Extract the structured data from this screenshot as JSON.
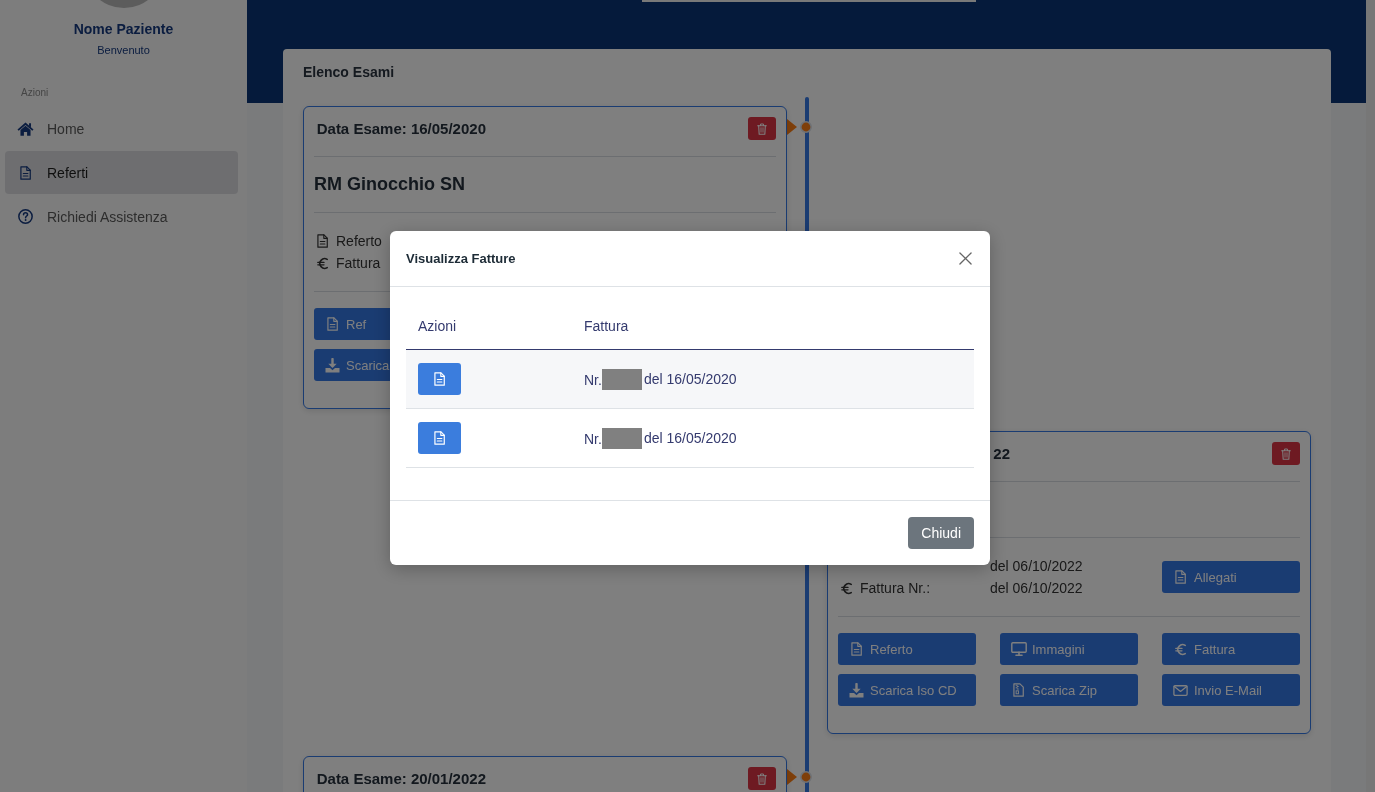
{
  "sidebar": {
    "name": "Nome Paziente",
    "greeting": "Benvenuto",
    "section": "Azioni",
    "items": [
      {
        "kind": "home",
        "label": "Home",
        "selected": false
      },
      {
        "kind": "file",
        "label": "Referti",
        "selected": true
      },
      {
        "kind": "help",
        "label": "Richiedi Assistenza",
        "selected": false
      }
    ]
  },
  "main": {
    "title": "Elenco Esami",
    "exams": [
      {
        "title": "Data Esame: 16/05/2020",
        "exam_name": "RM Ginocchio SN",
        "info_rows": [
          {
            "kind": "file",
            "label": "Referto"
          },
          {
            "kind": "euro",
            "label": "Fattura"
          }
        ],
        "button_rows": [
          [
            {
              "kind": "file",
              "label": "Ref"
            }
          ],
          [
            {
              "kind": "download",
              "label": "Scarica"
            }
          ]
        ]
      },
      {
        "title": "22",
        "info_rows": [
          {
            "value": "del 06/10/2022"
          },
          {
            "kind": "euro",
            "label": "Fattura Nr.:",
            "value": "del 06/10/2022"
          }
        ],
        "extra_button": {
          "kind": "file",
          "label": "Allegati"
        },
        "button_rows": [
          [
            {
              "kind": "file",
              "label": "Referto"
            },
            {
              "kind": "monitor",
              "label": "Immagini"
            },
            {
              "kind": "euro",
              "label": "Fattura"
            }
          ],
          [
            {
              "kind": "download",
              "label": "Scarica Iso CD"
            },
            {
              "kind": "zip",
              "label": "Scarica Zip"
            },
            {
              "kind": "mail",
              "label": "Invio E-Mail"
            }
          ]
        ]
      },
      {
        "title": "Data Esame: 20/01/2022"
      }
    ]
  },
  "dialog": {
    "title": "Visualizza Fatture",
    "columns": [
      "Azioni",
      "Fattura"
    ],
    "rows": [
      {
        "prefix": "Nr.",
        "redacted": true,
        "date": "del 16/05/2020"
      },
      {
        "prefix": "Nr.",
        "redacted": true,
        "date": "del 16/05/2020"
      }
    ],
    "close_label": "Chiudi"
  }
}
